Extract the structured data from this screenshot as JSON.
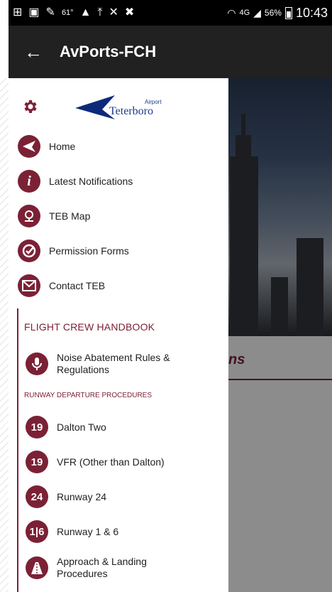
{
  "statusbar": {
    "temperature": "61°",
    "network": "4G",
    "battery": "56%",
    "time": "10:43"
  },
  "appbar": {
    "title": "AvPorts-FCH"
  },
  "logo": {
    "top_text": "Airport",
    "name": "Teterboro"
  },
  "nav": [
    {
      "label": "Home",
      "icon": "plane-icon"
    },
    {
      "label": "Latest Notifications",
      "icon": "info-icon"
    },
    {
      "label": "TEB Map",
      "icon": "map-pin-icon"
    },
    {
      "label": "Permission Forms",
      "icon": "check-circle-icon"
    },
    {
      "label": "Contact TEB",
      "icon": "envelope-icon"
    }
  ],
  "handbook": {
    "title": "FLIGHT CREW HANDBOOK",
    "noise_item": "Noise Abatement Rules & Regulations",
    "runway_section": "RUNWAY DEPARTURE PROCEDURES",
    "runways": [
      {
        "badge": "19",
        "label": "Dalton Two"
      },
      {
        "badge": "19",
        "label": "VFR (Other than Dalton)"
      },
      {
        "badge": "24",
        "label": "Runway 24"
      },
      {
        "badge": "1|6",
        "label": "Runway 1 & 6"
      }
    ],
    "approach_item": "Approach & Landing Procedures"
  },
  "background": {
    "heading_fragment": "ns"
  },
  "colors": {
    "accent": "#7b2136",
    "appbar": "#212121",
    "brand_blue": "#1a3a8c"
  }
}
